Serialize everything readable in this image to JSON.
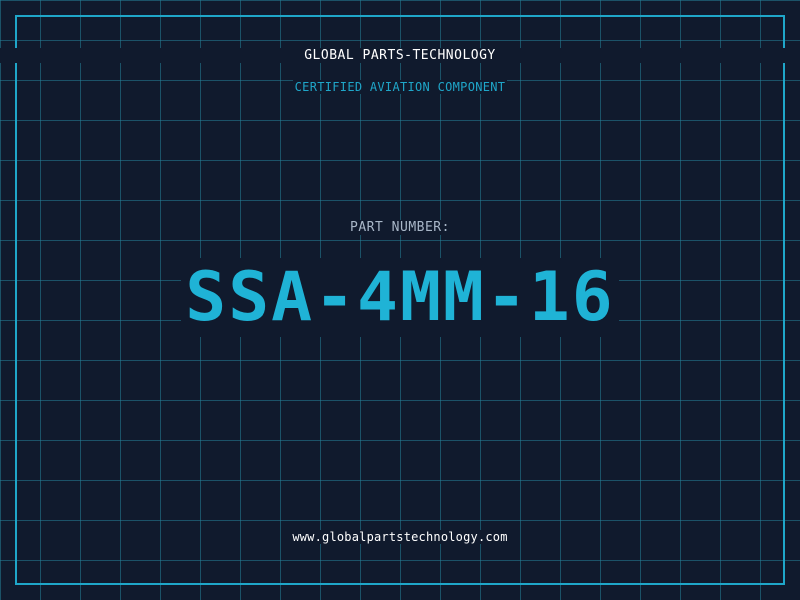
{
  "company": "GLOBAL PARTS-TECHNOLOGY",
  "subtitle": "CERTIFIED AVIATION COMPONENT",
  "part_label": "PART NUMBER:",
  "part_number": "SSA-4MM-16",
  "website": "www.globalpartstechnology.com",
  "colors": {
    "background": "#101a2d",
    "grid": "#258098",
    "accent": "#1fa6c9",
    "text": "#ffffff",
    "label": "#a9b7c8"
  }
}
